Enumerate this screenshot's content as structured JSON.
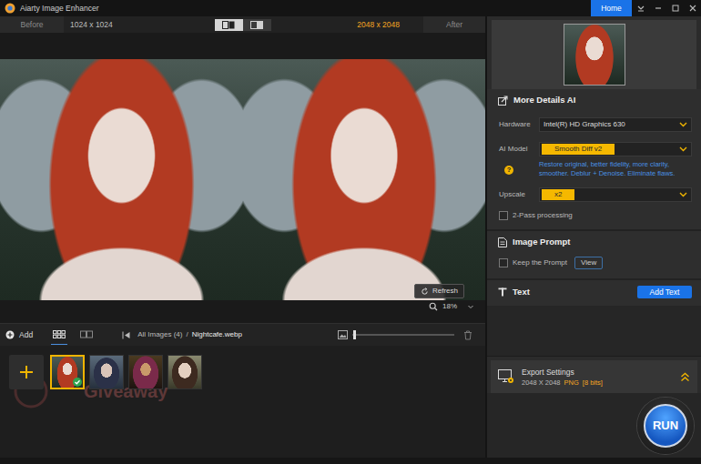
{
  "window": {
    "title": "Aiarty Image Enhancer",
    "home_button": "Home"
  },
  "compare_bar": {
    "before_label": "Before",
    "before_size": "1024 x 1024",
    "after_size": "2048 x 2048",
    "after_label": "After",
    "view_modes": [
      {
        "selected": true
      },
      {
        "selected": false
      }
    ]
  },
  "preview": {
    "refresh": "Refresh",
    "zoom": "18%"
  },
  "gallery": {
    "add": "Add",
    "layouts": [
      {
        "selected": true
      },
      {
        "selected": false
      }
    ],
    "breadcrumb_all": "All Images (4)",
    "separator": "/",
    "current_file": "Nightcafe.webp",
    "thumb_size_level": 0.02,
    "thumbnails": [
      {
        "selected": true,
        "processed": true
      },
      {
        "selected": false,
        "processed": false
      },
      {
        "selected": false,
        "processed": false
      },
      {
        "selected": false,
        "processed": false
      }
    ],
    "watermark": "Giveaway"
  },
  "settings": {
    "title": "More Details AI",
    "hardware": {
      "label": "Hardware",
      "value": "Intel(R) HD Graphics 630",
      "highlight": false
    },
    "ai_model": {
      "label": "AI Model",
      "value": "Smooth Diff v2",
      "highlight": true
    },
    "model_help": "?",
    "model_description": "Restore original, better fidelity, more clarity, smoother. Deblur + Denoise. Eliminate flaws.",
    "upscale": {
      "label": "Upscale",
      "value": "x2",
      "highlight": true
    },
    "two_pass": {
      "label": "2-Pass processing",
      "checked": false
    }
  },
  "image_prompt": {
    "title": "Image Prompt",
    "keep": {
      "label": "Keep the Prompt",
      "checked": false
    },
    "view_button": "View"
  },
  "text_section": {
    "title": "Text",
    "button": "Add Text"
  },
  "export": {
    "title": "Export Settings",
    "size": "2048 X 2048",
    "format": "PNG",
    "depth": "[8 bits]"
  },
  "run_button": "RUN"
}
